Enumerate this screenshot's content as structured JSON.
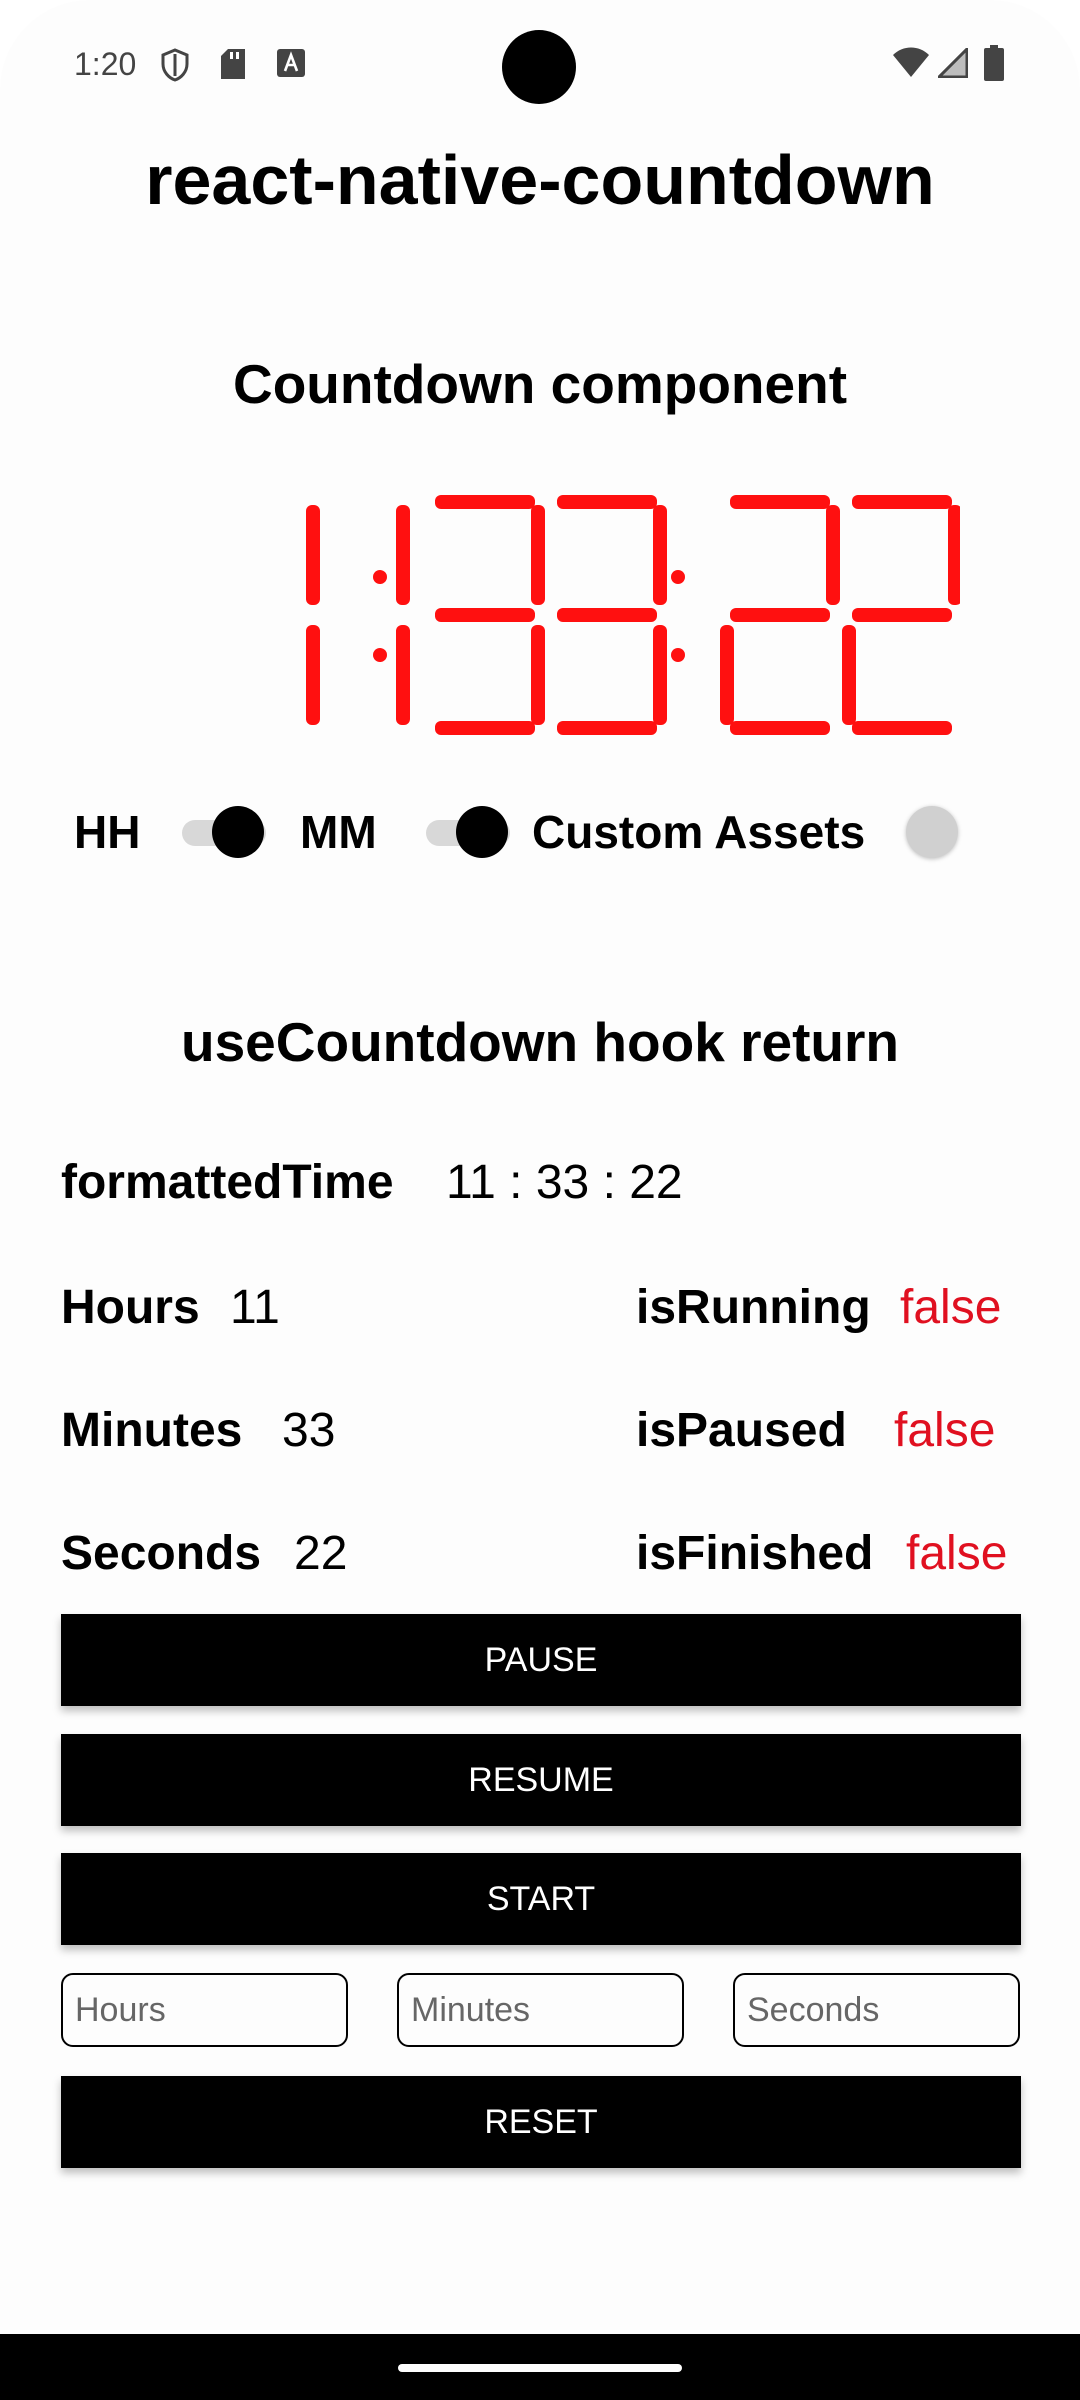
{
  "status_bar": {
    "time": "1:20",
    "icons": [
      "shield-icon",
      "sd-card-icon",
      "keyboard-a-icon",
      "wifi-icon",
      "signal-icon",
      "battery-icon"
    ]
  },
  "app": {
    "title": "react-native-countdown"
  },
  "countdown_component": {
    "heading": "Countdown component",
    "display": "11:33:22",
    "digits": [
      "1",
      "1",
      "3",
      "3",
      "2",
      "2"
    ],
    "color": "#ff1010",
    "toggles": [
      {
        "label": "HH",
        "on": true
      },
      {
        "label": "MM",
        "on": true
      },
      {
        "label": "Custom Assets",
        "on": false
      }
    ]
  },
  "hook": {
    "heading": "useCountdown hook return",
    "formatted_time": {
      "key": "formattedTime",
      "value": "11 : 33 : 22"
    },
    "hours": {
      "key": "Hours",
      "value": "11"
    },
    "minutes": {
      "key": "Minutes",
      "value": "33"
    },
    "seconds": {
      "key": "Seconds",
      "value": "22"
    },
    "is_running": {
      "key": "isRunning",
      "value": "false"
    },
    "is_paused": {
      "key": "isPaused",
      "value": "false"
    },
    "is_finished": {
      "key": "isFinished",
      "value": "false"
    }
  },
  "controls": {
    "pause_label": "PAUSE",
    "resume_label": "RESUME",
    "start_label": "START",
    "reset_label": "RESET",
    "hours_placeholder": "Hours",
    "minutes_placeholder": "Minutes",
    "seconds_placeholder": "Seconds"
  }
}
